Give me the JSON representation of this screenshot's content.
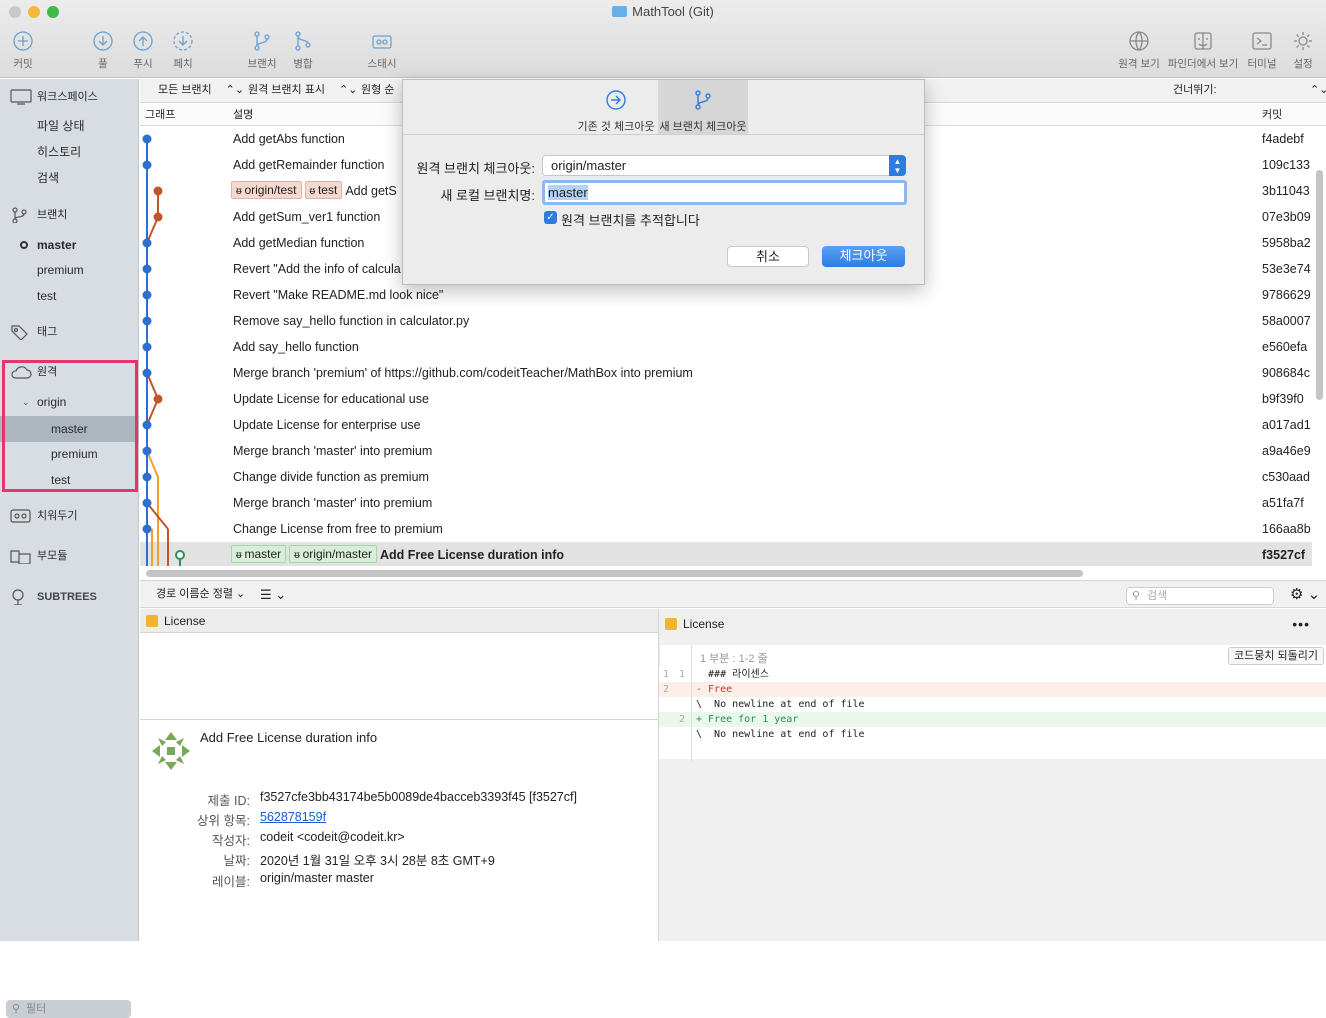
{
  "window": {
    "title": "MathTool (Git)"
  },
  "toolbar": {
    "commit": "커밋",
    "pull": "풀",
    "push": "푸시",
    "fetch": "페치",
    "branch": "브랜치",
    "merge": "병합",
    "stash": "스태시",
    "remote_view": "원격 보기",
    "finder_view": "파인더에서 보기",
    "terminal": "터미널",
    "settings": "설정"
  },
  "sidebar": {
    "workspace": "워크스페이스",
    "file_status": "파일 상태",
    "history": "히스토리",
    "search": "검색",
    "branches": "브랜치",
    "branch_items": [
      "master",
      "premium",
      "test"
    ],
    "tags": "태그",
    "remotes": "원격",
    "origin": "origin",
    "remote_items": [
      "master",
      "premium",
      "test"
    ],
    "stashes": "치워두기",
    "submodules": "부모듈",
    "subtrees": "SUBTREES",
    "filter_placeholder": "필터"
  },
  "branchbar": {
    "all_branches": "모든 브랜치",
    "show_remote": "원격 브랜치 표시",
    "order": "원형 순",
    "skip": "건너뛰기:"
  },
  "columns": {
    "graph": "그래프",
    "description": "설명",
    "commit": "커밋"
  },
  "commits": [
    {
      "desc": "Add getAbs function",
      "hash": "f4adebf"
    },
    {
      "desc": "Add getRemainder function",
      "hash": "109c133"
    },
    {
      "tags": [
        "origin/test",
        "test"
      ],
      "desc": "Add getS",
      "hash": "3b11043"
    },
    {
      "desc": "Add getSum_ver1 function",
      "hash": "07e3b09"
    },
    {
      "desc": "Add getMedian function",
      "hash": "5958ba2"
    },
    {
      "desc": "Revert \"Add the info of calcula",
      "hash": "53e3e74"
    },
    {
      "desc": "Revert \"Make README.md look nice\"",
      "hash": "9786629"
    },
    {
      "desc": "Remove say_hello function in calculator.py",
      "hash": "58a0007"
    },
    {
      "desc": "Add say_hello function",
      "hash": "e560efa"
    },
    {
      "desc": "Merge branch 'premium' of https://github.com/codeitTeacher/MathBox into premium",
      "hash": "908684c"
    },
    {
      "desc": "Update License for educational use",
      "hash": "b9f39f0"
    },
    {
      "desc": "Update License for enterprise use",
      "hash": "a017ad1"
    },
    {
      "desc": "Merge branch 'master' into premium",
      "hash": "a9a46e9"
    },
    {
      "desc": "Change divide function as premium",
      "hash": "c530aad"
    },
    {
      "desc": "Merge branch 'master' into premium",
      "hash": "a51fa7f"
    },
    {
      "desc": "Change License from free to premium",
      "hash": "166aa8b"
    },
    {
      "tags": [
        "master",
        "origin/master"
      ],
      "desc": "Add Free License duration info",
      "hash": "f3527cf",
      "selected": true
    }
  ],
  "midbar": {
    "sort": "경로 이름순 정렬",
    "search_placeholder": "검색"
  },
  "file": {
    "name": "License"
  },
  "commit_info": {
    "title": "Add Free License duration info",
    "id_label": "제출 ID:",
    "id": "f3527cfe3bb43174be5b0089de4bacceb3393f45 [f3527cf]",
    "parent_label": "상위 항목:",
    "parent": "562878159f",
    "author_label": "작성자:",
    "author": "codeit <codeit@codeit.kr>",
    "date_label": "날짜:",
    "date": "2020년 1월 31일 오후 3시 28분 8초 GMT+9",
    "labels_label": "레이블:",
    "labels": "origin/master master"
  },
  "diff": {
    "file": "License",
    "hunk": "1 부분 : 1-2 줄",
    "discard": "코드뭉치 되돌리기",
    "lines": [
      {
        "o": "1",
        "n": "1",
        "text": "  ### 라이센스",
        "kind": "ctx"
      },
      {
        "o": "2",
        "n": "",
        "text": "- Free",
        "kind": "del"
      },
      {
        "o": "",
        "n": "",
        "text": "\\  No newline at end of file",
        "kind": "ctx"
      },
      {
        "o": "",
        "n": "2",
        "text": "+ Free for 1 year",
        "kind": "add"
      },
      {
        "o": "",
        "n": "",
        "text": "\\  No newline at end of file",
        "kind": "ctx"
      }
    ]
  },
  "dialog": {
    "tab_existing": "기존 것 체크아웃",
    "tab_new": "새 브랜치 체크아웃",
    "remote_label": "원격 브랜치 체크아웃:",
    "remote_value": "origin/master",
    "local_label": "새 로컬 브랜치명:",
    "local_value": "master",
    "track_label": "원격 브랜치를 추적합니다",
    "cancel": "취소",
    "checkout": "체크아웃"
  },
  "colors": {
    "blue_line": "#2f6fd0",
    "red_line": "#c0542a",
    "orange_line": "#f0a030",
    "green_line": "#2f8f5f",
    "highlight": "#e8336d",
    "accent": "#2d7de0"
  }
}
